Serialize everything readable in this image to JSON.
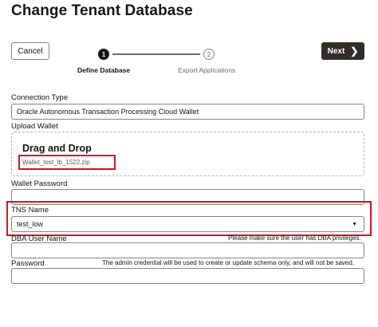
{
  "page": {
    "title": "Change Tenant Database"
  },
  "toolbar": {
    "cancel_label": "Cancel",
    "next_label": "Next"
  },
  "train": {
    "steps": [
      {
        "number": "1",
        "label": "Define Database"
      },
      {
        "number": "2",
        "label": "Export Applications"
      }
    ]
  },
  "form": {
    "connection_type": {
      "label": "Connection Type",
      "value": "Oracle Autonomous Transaction Processing Cloud Wallet"
    },
    "upload_wallet": {
      "label": "Upload Wallet",
      "dropzone_title": "Drag and Drop",
      "file_name": "Wallet_test_lb_1522.zip"
    },
    "wallet_password": {
      "label": "Wallet Password",
      "value": ""
    },
    "tns_name": {
      "label": "TNS Name",
      "value": "test_low"
    },
    "dba_user_name": {
      "label": "DBA User Name",
      "hint": "Please make sure the user has DBA privileges.",
      "value": ""
    },
    "password": {
      "label": "Password",
      "hint": "The admin credential will be used to create or update schema only, and will not be saved.",
      "value": ""
    }
  },
  "colors": {
    "highlight": "#d9131c",
    "primary_button": "#312d2a"
  }
}
